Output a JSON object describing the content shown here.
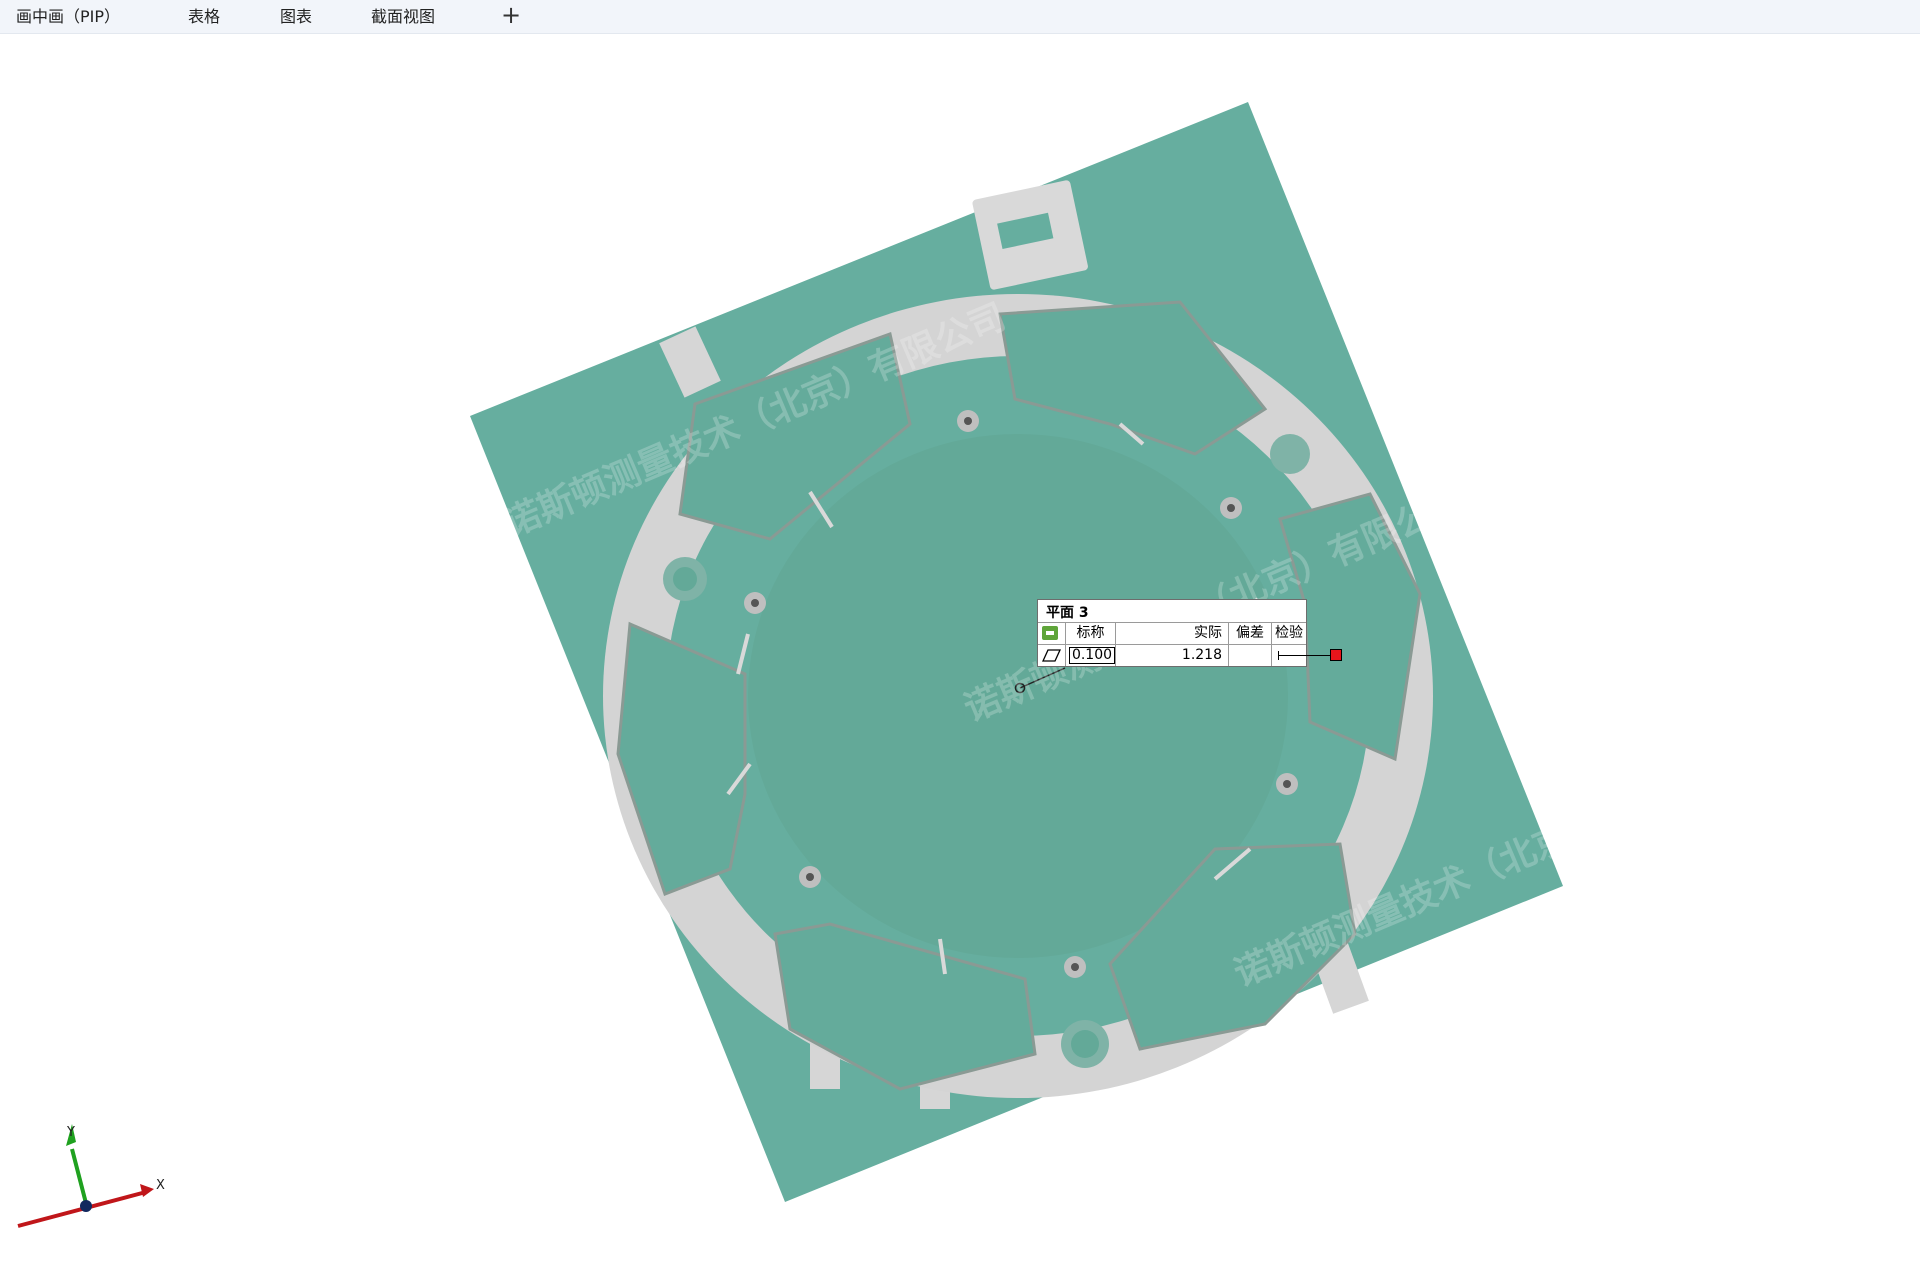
{
  "tabs": [
    {
      "label": "画中画（PIP）"
    },
    {
      "label": "表格"
    },
    {
      "label": "图表"
    },
    {
      "label": "截面视图"
    }
  ],
  "add_tab_label": "+",
  "label": {
    "title": "平面 3",
    "headers": {
      "nominal": "标称",
      "actual": "实际",
      "deviation": "偏差",
      "check": "检验"
    },
    "nominal": "0.100",
    "actual": "1.218",
    "deviation": "",
    "status_color": "#e8151b",
    "icon": "flatness-icon"
  },
  "axes": {
    "x": "X",
    "y": "Y",
    "x_color": "#c0161a",
    "y_color": "#1fa11f"
  },
  "watermark": [
    "诺斯顿测量技术（北京）有限公司"
  ],
  "colors": {
    "plane": "#66ae9f",
    "part": "#d4d4d4",
    "background": "#ffffff"
  }
}
